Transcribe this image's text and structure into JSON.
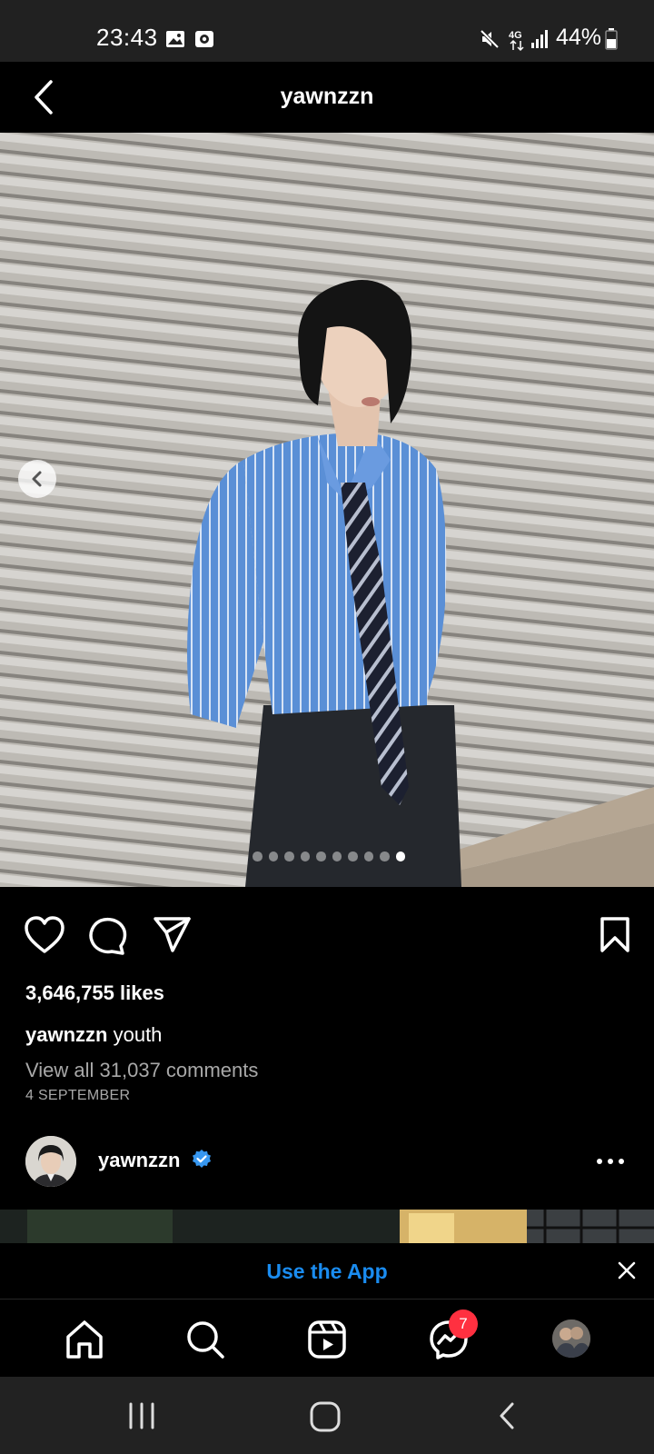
{
  "status_bar": {
    "time": "23:43",
    "battery": "44%",
    "network": "4G",
    "icons": [
      "gallery-icon",
      "screen-record-icon",
      "mute-icon",
      "network-4g-icon",
      "signal-icon",
      "battery-icon"
    ]
  },
  "header": {
    "title": "yawnzzn",
    "back_icon": "chevron-left-icon"
  },
  "post": {
    "carousel": {
      "total": 10,
      "current": 10
    },
    "likes": "3,646,755 likes",
    "caption_user": "yawnzzn",
    "caption_text": "youth",
    "view_comments": "View all 31,037 comments",
    "date": "4 SEPTEMBER",
    "actions": [
      "heart-icon",
      "comment-icon",
      "share-icon",
      "bookmark-icon"
    ]
  },
  "next_post": {
    "username": "yawnzzn",
    "verified": true
  },
  "banner": {
    "label": "Use the App",
    "accent": "#1a8cf0"
  },
  "bottom_nav": {
    "items": [
      "home-icon",
      "search-icon",
      "reels-icon",
      "messenger-icon",
      "profile-avatar"
    ],
    "messenger_badge": "7",
    "badge_color": "#ff3040"
  },
  "system_nav": [
    "recents-icon",
    "home-button-icon",
    "back-icon"
  ]
}
